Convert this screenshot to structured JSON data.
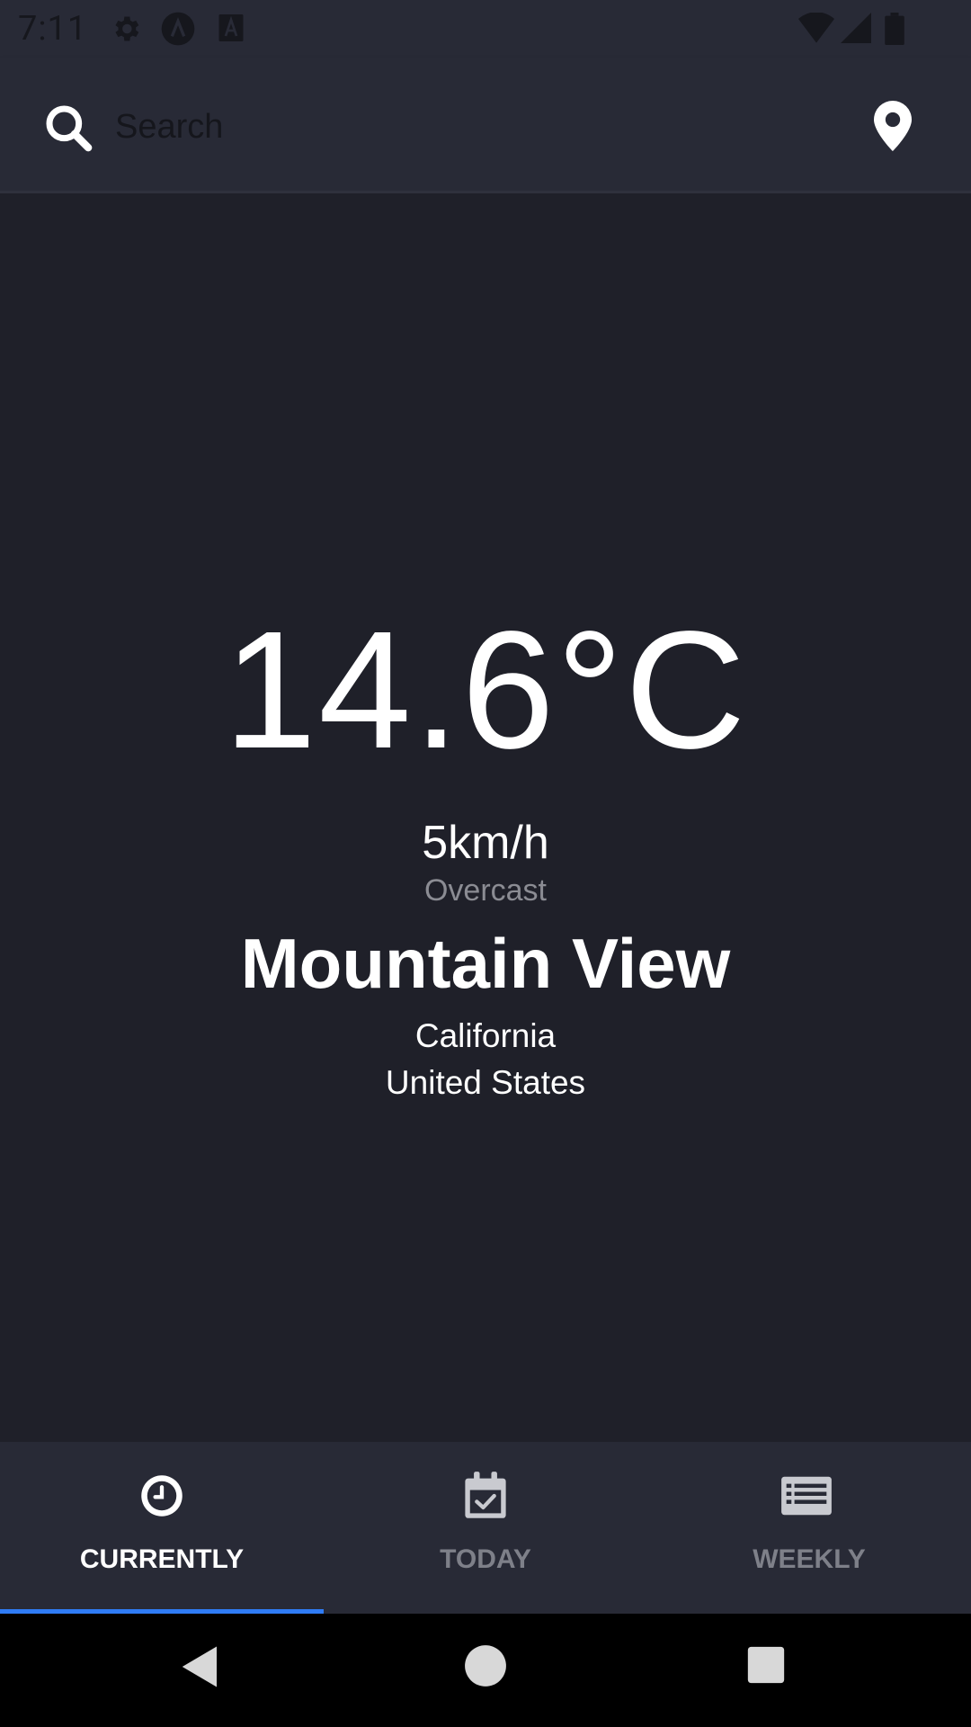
{
  "status_bar": {
    "time": "7:11",
    "left_icons": [
      "settings-icon",
      "app-badge-icon",
      "a-text-icon"
    ],
    "right_icons": [
      "wifi-icon",
      "signal-icon",
      "battery-icon"
    ]
  },
  "search": {
    "placeholder": "Search",
    "value": "",
    "search_icon": "search-icon",
    "location_icon": "location-pin-icon"
  },
  "weather": {
    "temperature": "14.6°C",
    "wind": "5km/h",
    "condition": "Overcast",
    "city": "Mountain View",
    "region": "California",
    "country": "United States"
  },
  "tabs": [
    {
      "label": "CURRENTLY",
      "icon": "clock-icon",
      "active": true
    },
    {
      "label": "TODAY",
      "icon": "calendar-check-icon",
      "active": false
    },
    {
      "label": "WEEKLY",
      "icon": "list-icon",
      "active": false
    }
  ],
  "nav_bar": {
    "buttons": [
      "back-icon",
      "home-icon",
      "recents-icon"
    ]
  },
  "colors": {
    "background": "#1f2029",
    "bar_background": "#282a36",
    "accent": "#2f7cf6",
    "text_primary": "#ffffff",
    "text_secondary": "#8b8c93",
    "tab_inactive": "#7e8089"
  }
}
